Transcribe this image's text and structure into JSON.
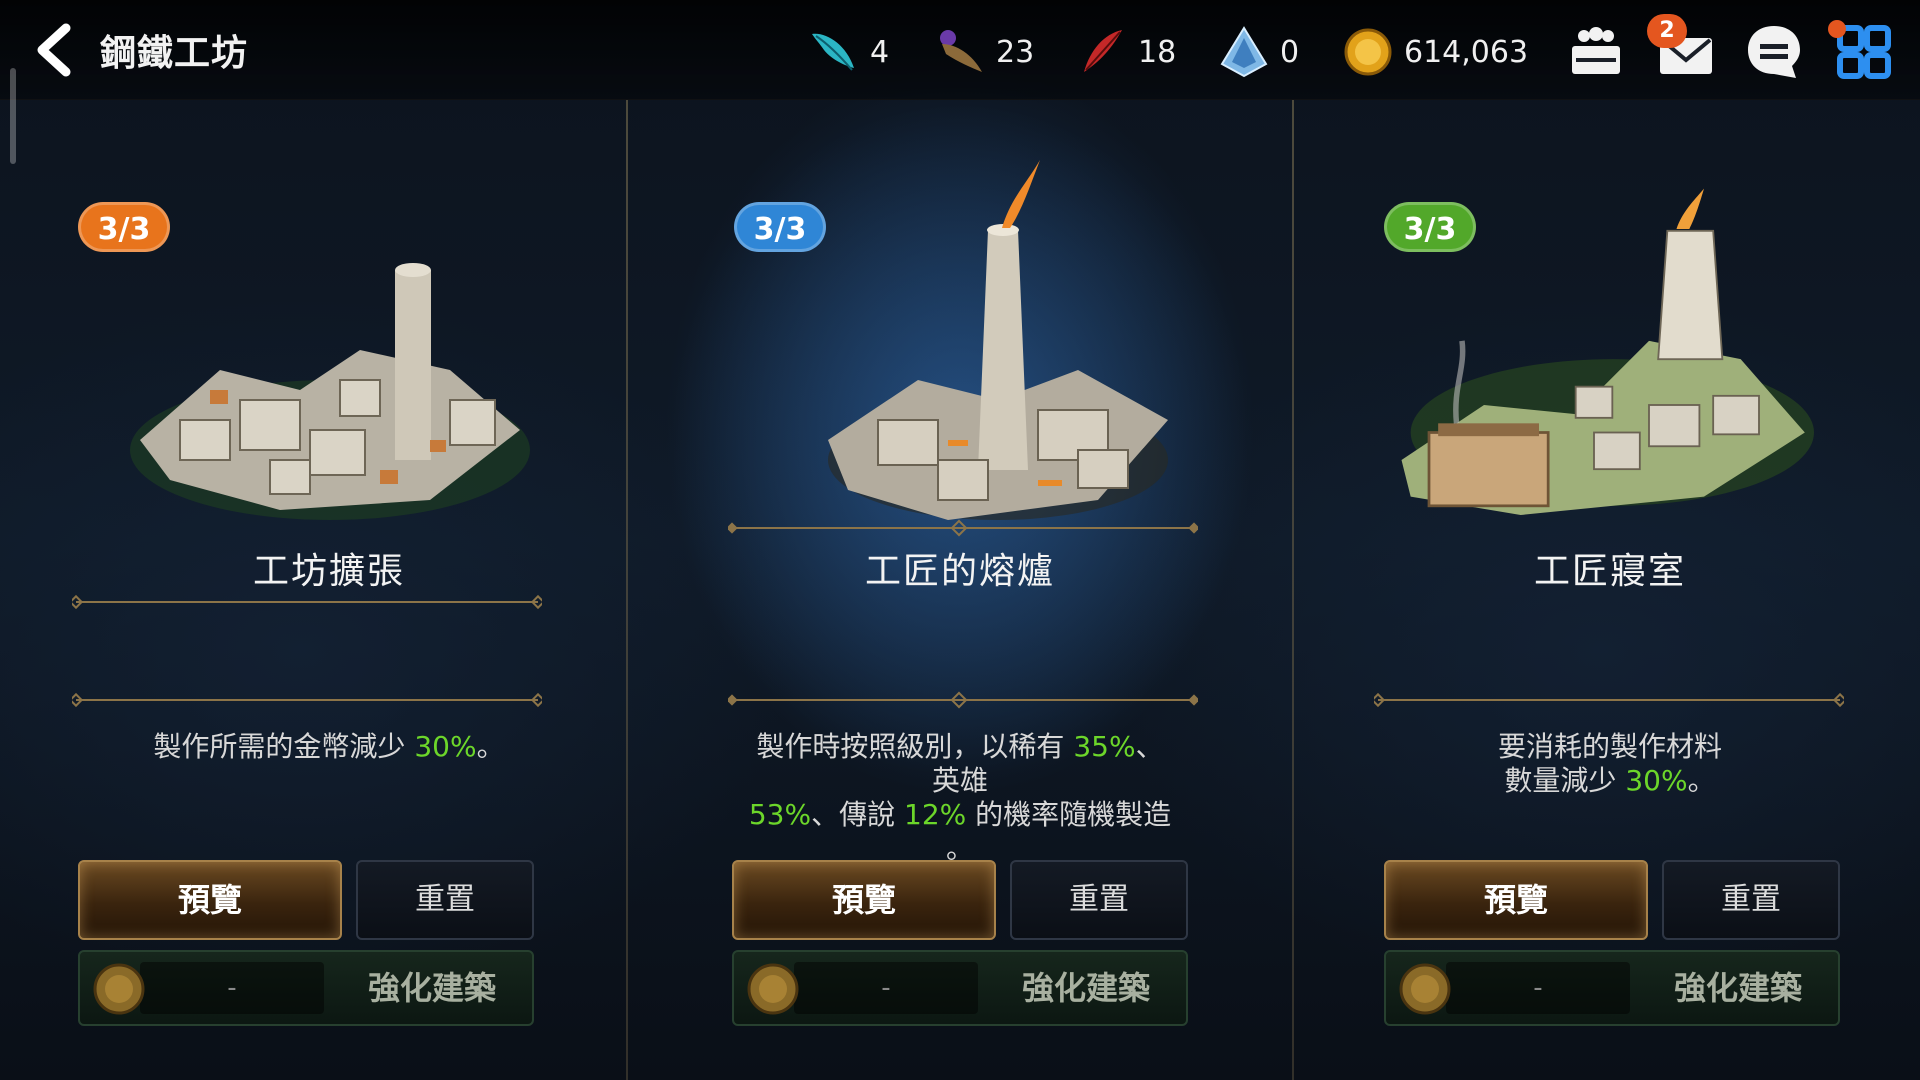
{
  "header": {
    "title": "鋼鐵工坊",
    "currencies": [
      {
        "name": "feather-icon",
        "value": "4"
      },
      {
        "name": "horn-icon",
        "value": "23"
      },
      {
        "name": "red-feather-icon",
        "value": "18"
      },
      {
        "name": "crystal-icon",
        "value": "0"
      },
      {
        "name": "gold-coin-icon",
        "value": "614,063"
      }
    ],
    "mail_count": "2"
  },
  "cards": [
    {
      "level": "3/3",
      "badge_color": "#e8741c",
      "title": "工坊擴張",
      "desc_line1_pre": "製作所需的金幣減少 ",
      "desc_line1_val": "30%",
      "desc_line1_post": "。",
      "preview_label": "預覽",
      "reset_label": "重置",
      "enhance_cost": "-",
      "enhance_label": "強化建築"
    },
    {
      "level": "3/3",
      "badge_color": "#2f86d6",
      "title": "工匠的熔爐",
      "desc_line1_pre": "製作時按照級別，以稀有 ",
      "desc_line1_val": "35%",
      "desc_line1_post": "、",
      "desc_line2": "英雄",
      "desc_line3_val1": "53%",
      "desc_line3_mid": "、傳說 ",
      "desc_line3_val2": "12%",
      "desc_line3_post": " 的機率隨機製造",
      "desc_line4": "。",
      "preview_label": "預覽",
      "reset_label": "重置",
      "enhance_cost": "-",
      "enhance_label": "強化建築"
    },
    {
      "level": "3/3",
      "badge_color": "#52a82a",
      "title": "工匠寢室",
      "desc_line1": "要消耗的製作材料",
      "desc_line2_pre": "數量減少 ",
      "desc_line2_val": "30%",
      "desc_line2_post": "。",
      "preview_label": "預覽",
      "reset_label": "重置",
      "enhance_cost": "-",
      "enhance_label": "強化建築"
    }
  ]
}
